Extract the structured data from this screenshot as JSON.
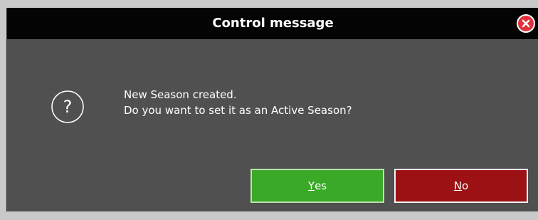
{
  "dialog": {
    "title": "Control message",
    "close_icon": "close-icon",
    "icon": "question-icon",
    "icon_glyph": "?",
    "message_line1": "New Season created.",
    "message_line2": "Do you want to set it as an Active Season?",
    "buttons": {
      "yes": {
        "label_first": "Y",
        "label_rest": "es",
        "color": "#3aa928"
      },
      "no": {
        "label_first": "N",
        "label_rest": "o",
        "color": "#9b1114"
      }
    }
  },
  "colors": {
    "titlebar": "#040404",
    "body": "#505050",
    "close": "#e0313a"
  }
}
